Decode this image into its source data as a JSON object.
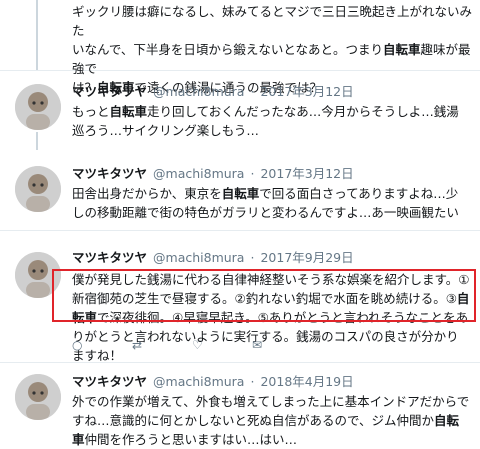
{
  "top_tweet": {
    "line1": "ギックリ腰は癖になるし、妹みてるとマジで三日三晩起き上がれないみた",
    "line2": "いなんで、下半身を日頃から鍛えないとなあと。つまり",
    "kw1": "自転車",
    "line2b": "趣味が最強で",
    "line3a": "は？",
    "kw2": "自転車",
    "line3b": "で遠くの銭湯に通うの最強では？"
  },
  "tweets": [
    {
      "name": "マツキタツヤ",
      "handle": "@machi8mura",
      "date": "2017年3月12日",
      "text_a": "もっと",
      "kw": "自転車",
      "text_b": "走り回しておくんだったなあ…今月からそうしよ…銭湯巡ろう…サイクリング楽しもう…"
    },
    {
      "name": "マツキタツヤ",
      "handle": "@machi8mura",
      "date": "2017年3月12日",
      "text_a": "田舎出身だからか、東京を",
      "kw": "自転車",
      "text_b": "で回る面白さってありますよね…少しの移動距離で街の特色がガラリと変わるんですよ…あ一映画観たい"
    },
    {
      "name": "マツキタツヤ",
      "handle": "@machi8mura",
      "date": "2017年9月29日",
      "text_a": "僕が発見した銭湯に代わる自律神経整いそう系な娯楽を紹介します。①新宿御苑の芝生で昼寝する。②釣れない釣堀で水面を眺め続ける。③",
      "kw": "自転車",
      "text_b": "で深夜徘徊。④早寝早起き。⑤ありがとうと言われそうなことをありがとうと言われないように実行する。銭湯のコスパの良さが分かりますね！"
    },
    {
      "name": "マツキタツヤ",
      "handle": "@machi8mura",
      "date": "2018年4月19日",
      "text_a": "外での作業が増えて、外食も増えてしまった上に基本インドアだからですね…意識的に何とかしないと死ぬ自信があるので、ジム仲間か",
      "kw": "自転車",
      "text_b": "仲間を作ろうと思いますはい…はい…"
    }
  ],
  "actions": {
    "reply": "○",
    "retweet": "⇄",
    "like": "♡",
    "dm": "✉"
  },
  "colors": {
    "highlight": "#e0242a",
    "meta": "#657786"
  }
}
